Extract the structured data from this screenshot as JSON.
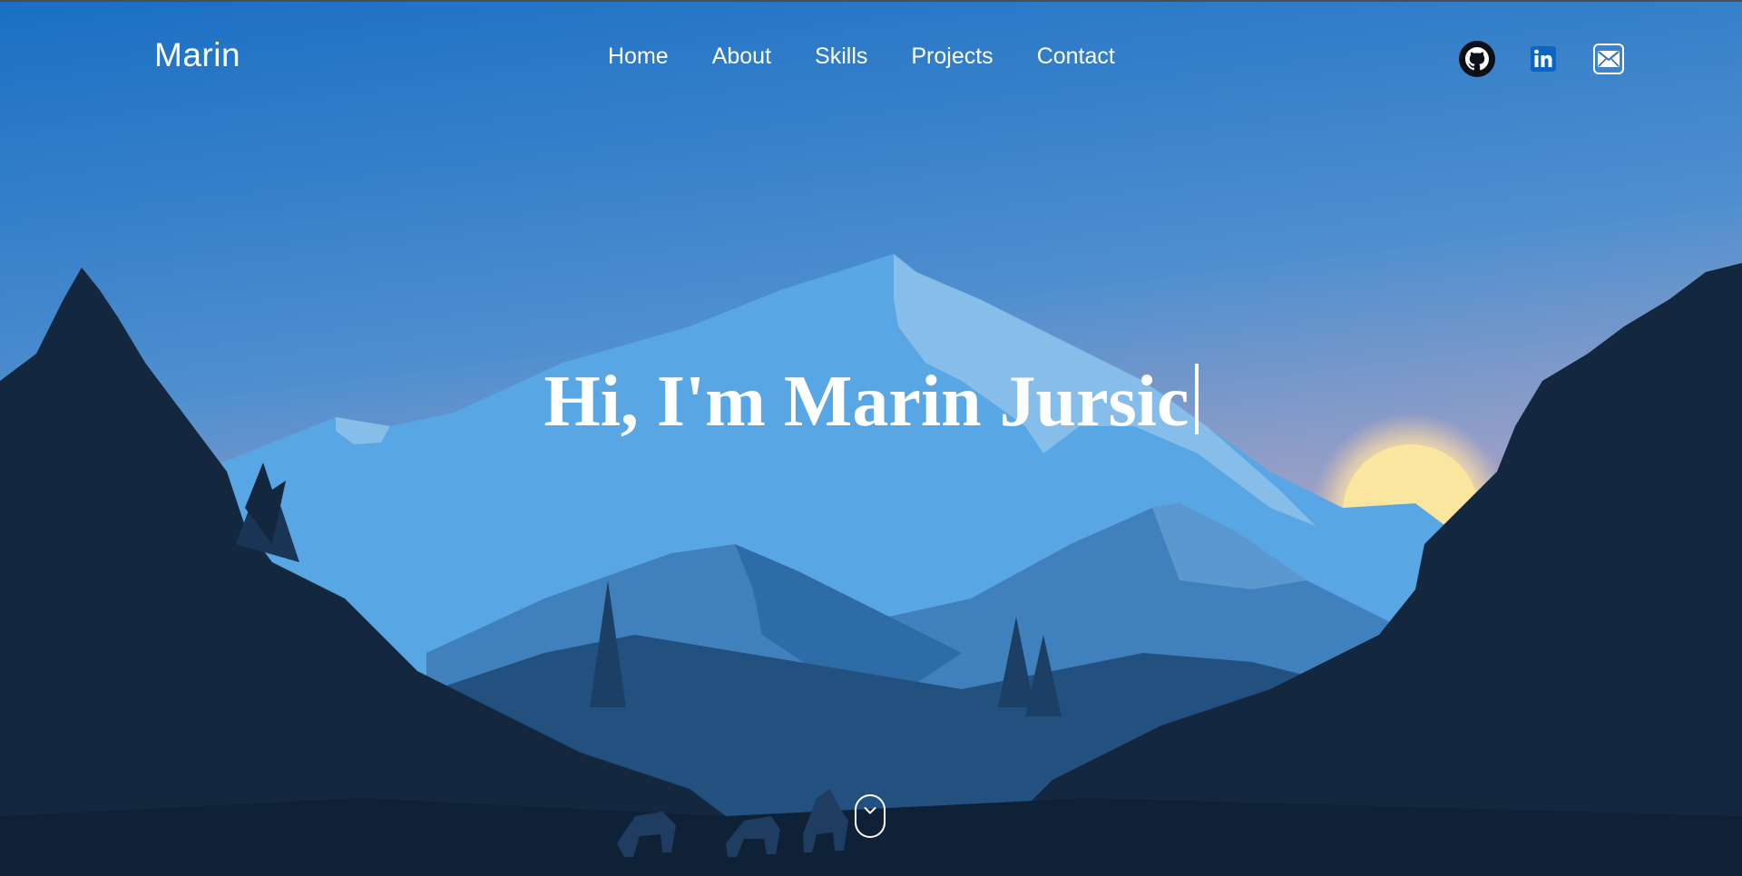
{
  "brand": {
    "name": "Marin"
  },
  "nav": {
    "home": "Home",
    "about": "About",
    "skills": "Skills",
    "projects": "Projects",
    "contact": "Contact"
  },
  "social": {
    "github_icon": "github-icon",
    "linkedin_icon": "linkedin-icon",
    "email_icon": "mail-icon"
  },
  "hero": {
    "headline": "Hi, I'm Marin Jursic",
    "scroll_icon": "chevron-down-icon"
  },
  "colors": {
    "sky_top": "#1f74c6",
    "sky_bottom": "#c9a7b4",
    "mountain_light": "#57a6e3",
    "mountain_mid": "#2d6da8",
    "forest": "#13273f",
    "sun": "#f6e39a",
    "linkedin_blue": "#0a66c2"
  }
}
